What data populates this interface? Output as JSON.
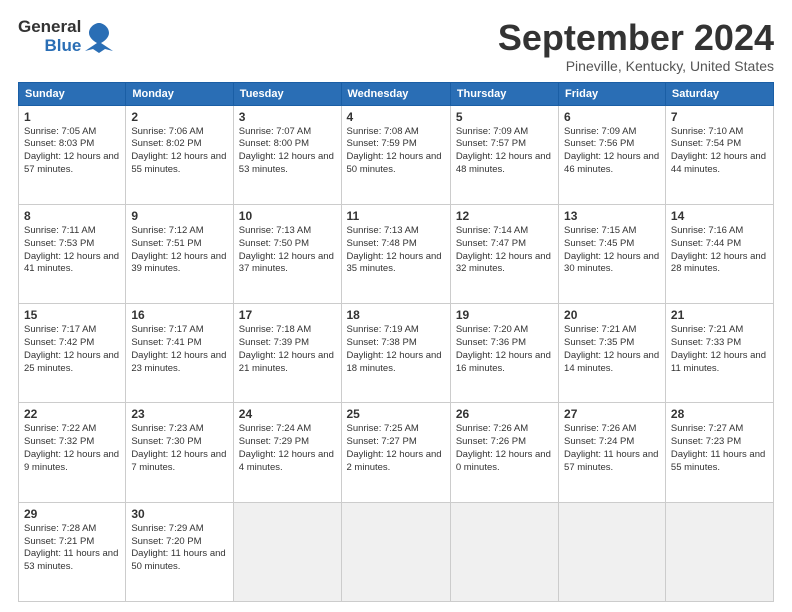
{
  "logo": {
    "line1": "General",
    "line2": "Blue"
  },
  "title": "September 2024",
  "subtitle": "Pineville, Kentucky, United States",
  "days_of_week": [
    "Sunday",
    "Monday",
    "Tuesday",
    "Wednesday",
    "Thursday",
    "Friday",
    "Saturday"
  ],
  "weeks": [
    [
      {
        "day": "1",
        "sunrise": "7:05 AM",
        "sunset": "8:03 PM",
        "daylight": "12 hours and 57 minutes."
      },
      {
        "day": "2",
        "sunrise": "7:06 AM",
        "sunset": "8:02 PM",
        "daylight": "12 hours and 55 minutes."
      },
      {
        "day": "3",
        "sunrise": "7:07 AM",
        "sunset": "8:00 PM",
        "daylight": "12 hours and 53 minutes."
      },
      {
        "day": "4",
        "sunrise": "7:08 AM",
        "sunset": "7:59 PM",
        "daylight": "12 hours and 50 minutes."
      },
      {
        "day": "5",
        "sunrise": "7:09 AM",
        "sunset": "7:57 PM",
        "daylight": "12 hours and 48 minutes."
      },
      {
        "day": "6",
        "sunrise": "7:09 AM",
        "sunset": "7:56 PM",
        "daylight": "12 hours and 46 minutes."
      },
      {
        "day": "7",
        "sunrise": "7:10 AM",
        "sunset": "7:54 PM",
        "daylight": "12 hours and 44 minutes."
      }
    ],
    [
      {
        "day": "8",
        "sunrise": "7:11 AM",
        "sunset": "7:53 PM",
        "daylight": "12 hours and 41 minutes."
      },
      {
        "day": "9",
        "sunrise": "7:12 AM",
        "sunset": "7:51 PM",
        "daylight": "12 hours and 39 minutes."
      },
      {
        "day": "10",
        "sunrise": "7:13 AM",
        "sunset": "7:50 PM",
        "daylight": "12 hours and 37 minutes."
      },
      {
        "day": "11",
        "sunrise": "7:13 AM",
        "sunset": "7:48 PM",
        "daylight": "12 hours and 35 minutes."
      },
      {
        "day": "12",
        "sunrise": "7:14 AM",
        "sunset": "7:47 PM",
        "daylight": "12 hours and 32 minutes."
      },
      {
        "day": "13",
        "sunrise": "7:15 AM",
        "sunset": "7:45 PM",
        "daylight": "12 hours and 30 minutes."
      },
      {
        "day": "14",
        "sunrise": "7:16 AM",
        "sunset": "7:44 PM",
        "daylight": "12 hours and 28 minutes."
      }
    ],
    [
      {
        "day": "15",
        "sunrise": "7:17 AM",
        "sunset": "7:42 PM",
        "daylight": "12 hours and 25 minutes."
      },
      {
        "day": "16",
        "sunrise": "7:17 AM",
        "sunset": "7:41 PM",
        "daylight": "12 hours and 23 minutes."
      },
      {
        "day": "17",
        "sunrise": "7:18 AM",
        "sunset": "7:39 PM",
        "daylight": "12 hours and 21 minutes."
      },
      {
        "day": "18",
        "sunrise": "7:19 AM",
        "sunset": "7:38 PM",
        "daylight": "12 hours and 18 minutes."
      },
      {
        "day": "19",
        "sunrise": "7:20 AM",
        "sunset": "7:36 PM",
        "daylight": "12 hours and 16 minutes."
      },
      {
        "day": "20",
        "sunrise": "7:21 AM",
        "sunset": "7:35 PM",
        "daylight": "12 hours and 14 minutes."
      },
      {
        "day": "21",
        "sunrise": "7:21 AM",
        "sunset": "7:33 PM",
        "daylight": "12 hours and 11 minutes."
      }
    ],
    [
      {
        "day": "22",
        "sunrise": "7:22 AM",
        "sunset": "7:32 PM",
        "daylight": "12 hours and 9 minutes."
      },
      {
        "day": "23",
        "sunrise": "7:23 AM",
        "sunset": "7:30 PM",
        "daylight": "12 hours and 7 minutes."
      },
      {
        "day": "24",
        "sunrise": "7:24 AM",
        "sunset": "7:29 PM",
        "daylight": "12 hours and 4 minutes."
      },
      {
        "day": "25",
        "sunrise": "7:25 AM",
        "sunset": "7:27 PM",
        "daylight": "12 hours and 2 minutes."
      },
      {
        "day": "26",
        "sunrise": "7:26 AM",
        "sunset": "7:26 PM",
        "daylight": "12 hours and 0 minutes."
      },
      {
        "day": "27",
        "sunrise": "7:26 AM",
        "sunset": "7:24 PM",
        "daylight": "11 hours and 57 minutes."
      },
      {
        "day": "28",
        "sunrise": "7:27 AM",
        "sunset": "7:23 PM",
        "daylight": "11 hours and 55 minutes."
      }
    ],
    [
      {
        "day": "29",
        "sunrise": "7:28 AM",
        "sunset": "7:21 PM",
        "daylight": "11 hours and 53 minutes."
      },
      {
        "day": "30",
        "sunrise": "7:29 AM",
        "sunset": "7:20 PM",
        "daylight": "11 hours and 50 minutes."
      },
      null,
      null,
      null,
      null,
      null
    ]
  ]
}
